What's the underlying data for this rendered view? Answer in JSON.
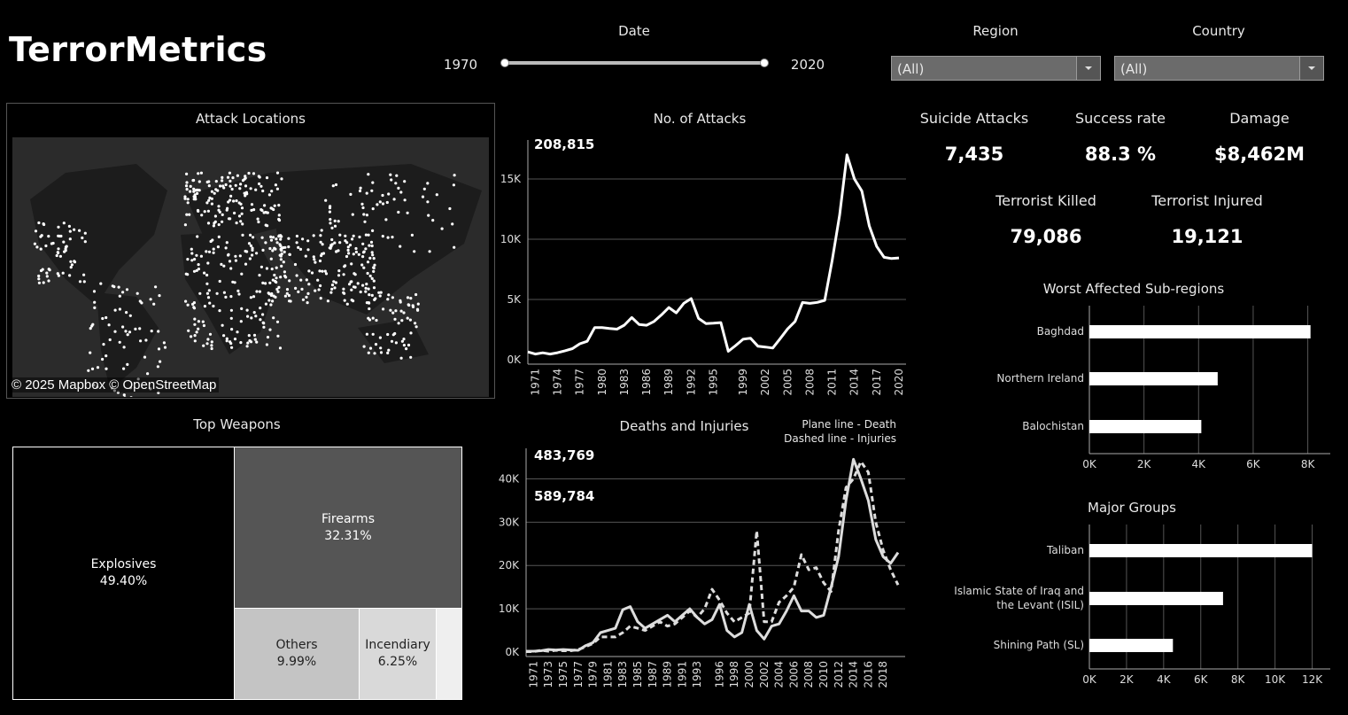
{
  "header": {
    "title": "TerrorMetrics"
  },
  "filters": {
    "date_label": "Date",
    "date_start": "1970",
    "date_end": "2020",
    "region_label": "Region",
    "region_value": "(All)",
    "country_label": "Country",
    "country_value": "(All)"
  },
  "map": {
    "title": "Attack Locations",
    "credit": "© 2025 Mapbox © OpenStreetMap"
  },
  "kpis": {
    "suicide_label": "Suicide Attacks",
    "suicide_value": "7,435",
    "success_label": "Success rate",
    "success_value": "88.3 %",
    "damage_label": "Damage",
    "damage_value": "$8,462M",
    "killed_label": "Terrorist Killed",
    "killed_value": "79,086",
    "injured_label": "Terrorist Injured",
    "injured_value": "19,121"
  },
  "weapons": {
    "title": "Top Weapons",
    "items": [
      {
        "name": "Explosives",
        "pct": "49.40%"
      },
      {
        "name": "Firearms",
        "pct": "32.31%"
      },
      {
        "name": "Others",
        "pct": "9.99%"
      },
      {
        "name": "Incendiary",
        "pct": "6.25%"
      }
    ]
  },
  "chart_data": [
    {
      "type": "line",
      "title": "No. of Attacks",
      "annotation": "208,815",
      "x": [
        1970,
        1971,
        1972,
        1973,
        1974,
        1975,
        1976,
        1977,
        1978,
        1979,
        1980,
        1981,
        1982,
        1983,
        1984,
        1985,
        1986,
        1987,
        1988,
        1989,
        1990,
        1991,
        1992,
        1993,
        1994,
        1995,
        1996,
        1997,
        1998,
        1999,
        2000,
        2001,
        2002,
        2003,
        2004,
        2005,
        2006,
        2007,
        2008,
        2009,
        2010,
        2011,
        2012,
        2013,
        2014,
        2015,
        2016,
        2017,
        2018,
        2019,
        2020
      ],
      "series": [
        {
          "values": [
            650,
            470,
            570,
            470,
            580,
            740,
            920,
            1320,
            1530,
            2660,
            2660,
            2590,
            2540,
            2870,
            3500,
            2920,
            2860,
            3180,
            3720,
            4330,
            3890,
            4680,
            5070,
            3430,
            3000,
            3030,
            3080,
            700,
            1180,
            1700,
            1790,
            1120,
            1050,
            970,
            1750,
            2560,
            3180,
            4750,
            4680,
            4760,
            4930,
            8240,
            12000,
            17000,
            15000,
            14000,
            11100,
            9400,
            8500,
            8400,
            8450
          ]
        }
      ],
      "xticks": [
        "1971",
        "1974",
        "1977",
        "1980",
        "1983",
        "1986",
        "1989",
        "1992",
        "1995",
        "1999",
        "2002",
        "2005",
        "2008",
        "2011",
        "2014",
        "2017",
        "2020"
      ],
      "ylim": [
        0,
        17500
      ],
      "yticks": [
        "0K",
        "5K",
        "10K",
        "15K"
      ]
    },
    {
      "type": "line",
      "title": "Deaths and Injuries",
      "legend": [
        "Plane line - Death",
        "Dashed line - Injuries"
      ],
      "annotations": [
        "483,769",
        "589,784"
      ],
      "x": [
        1970,
        1971,
        1972,
        1973,
        1974,
        1975,
        1976,
        1977,
        1978,
        1979,
        1980,
        1981,
        1982,
        1983,
        1984,
        1985,
        1986,
        1987,
        1988,
        1989,
        1990,
        1991,
        1992,
        1993,
        1994,
        1995,
        1996,
        1997,
        1998,
        1999,
        2000,
        2001,
        2002,
        2003,
        2004,
        2005,
        2006,
        2007,
        2008,
        2009,
        2010,
        2011,
        2012,
        2013,
        2014,
        2015,
        2016,
        2017,
        2018,
        2019,
        2020
      ],
      "series": [
        {
          "name": "Death",
          "dash": false,
          "values": [
            200,
            200,
            300,
            600,
            500,
            600,
            500,
            400,
            1500,
            2200,
            4500,
            5000,
            5500,
            9800,
            10500,
            7000,
            5500,
            6500,
            7500,
            8500,
            7000,
            8500,
            10000,
            8000,
            6500,
            7500,
            11000,
            5000,
            3500,
            4500,
            11000,
            5000,
            3000,
            6000,
            6500,
            9500,
            13000,
            9500,
            9500,
            8000,
            8500,
            15000,
            22000,
            35000,
            44500,
            40000,
            35000,
            26000,
            22000,
            20500,
            23000
          ]
        },
        {
          "name": "Injuries",
          "dash": true,
          "values": [
            100,
            100,
            400,
            200,
            400,
            300,
            300,
            600,
            1200,
            2000,
            3500,
            3500,
            3500,
            4500,
            6000,
            5500,
            5000,
            6000,
            7000,
            6000,
            6500,
            8000,
            9500,
            8000,
            10000,
            14500,
            12000,
            9000,
            7000,
            8000,
            9000,
            28000,
            7000,
            7000,
            11500,
            13000,
            15000,
            22500,
            19000,
            19500,
            16000,
            14000,
            28000,
            38000,
            40000,
            44000,
            41500,
            30000,
            23500,
            19000,
            15500
          ]
        }
      ],
      "xticks": [
        "1971",
        "1973",
        "1975",
        "1977",
        "1979",
        "1981",
        "1983",
        "1985",
        "1987",
        "1989",
        "1991",
        "1993",
        "1996",
        "1998",
        "2000",
        "2002",
        "2004",
        "2006",
        "2008",
        "2010",
        "2012",
        "2014",
        "2016",
        "2018"
      ],
      "ylim": [
        0,
        45000
      ],
      "yticks": [
        "0K",
        "10K",
        "20K",
        "30K",
        "40K"
      ]
    },
    {
      "type": "bar",
      "orientation": "horizontal",
      "title": "Worst Affected Sub-regions",
      "categories": [
        "Baghdad",
        "Northern Ireland",
        "Balochistan"
      ],
      "values": [
        8100,
        4700,
        4100
      ],
      "xlim": [
        0,
        8500
      ],
      "xticks": [
        "0K",
        "2K",
        "4K",
        "6K",
        "8K"
      ]
    },
    {
      "type": "bar",
      "orientation": "horizontal",
      "title": "Major Groups",
      "categories": [
        "Taliban",
        "Islamic State of Iraq and the Levant (ISIL)",
        "Shining Path (SL)"
      ],
      "values": [
        12000,
        7200,
        4500
      ],
      "xlim": [
        0,
        12500
      ],
      "xticks": [
        "0K",
        "2K",
        "4K",
        "6K",
        "8K",
        "10K",
        "12K"
      ]
    }
  ]
}
